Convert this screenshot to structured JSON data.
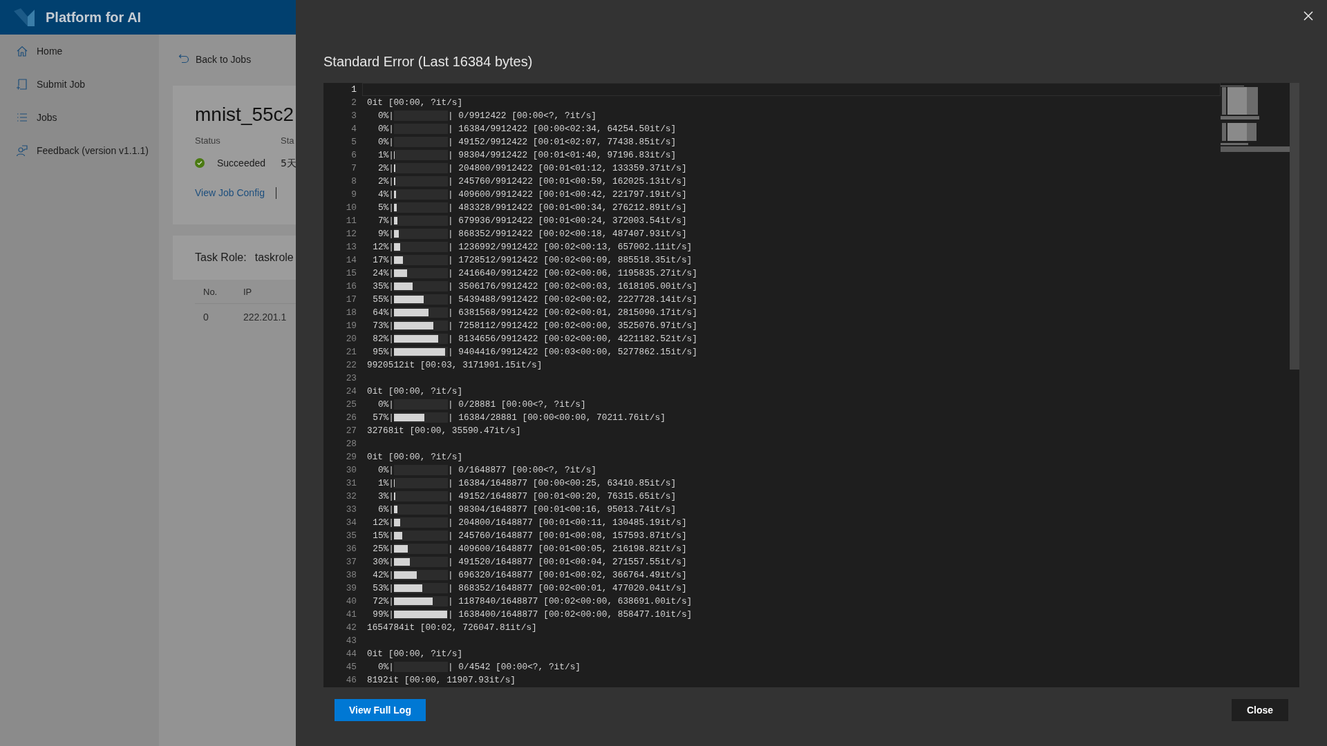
{
  "app": {
    "title": "Platform for AI"
  },
  "sidebar": {
    "items": [
      {
        "label": "Home"
      },
      {
        "label": "Submit Job"
      },
      {
        "label": "Jobs"
      },
      {
        "label": "Feedback (version v1.1.1)"
      }
    ]
  },
  "job": {
    "back": "Back to Jobs",
    "name": "mnist_55c2",
    "status_label": "Status",
    "start_label": "Sta",
    "status": "Succeeded",
    "start": "5天",
    "config_link": "View Job Config"
  },
  "task": {
    "label": "Task Role:",
    "value": "taskrole",
    "columns": [
      "No.",
      "IP"
    ],
    "rows": [
      [
        "0",
        "222.201.1"
      ]
    ]
  },
  "dialog": {
    "title": "Standard Error (Last 16384 bytes)",
    "full_log_button": "View Full Log",
    "close_button": "Close",
    "lines": [
      {
        "no": "1",
        "kind": "text",
        "current": true
      },
      {
        "no": "2",
        "kind": "text",
        "text": "0it [00:00, ?it/s]",
        "current": false
      },
      {
        "no": "3",
        "kind": "progress",
        "label": "0%|",
        "level": 0,
        "rest": "| 0/9912422 [00:00<?, ?it/s]",
        "current": false
      },
      {
        "no": "4",
        "kind": "progress",
        "label": "0%|",
        "level": 0,
        "rest": "| 16384/9912422 [00:00<02:34, 64254.50it/s]",
        "current": false
      },
      {
        "no": "5",
        "kind": "progress",
        "label": "0%|",
        "level": 0,
        "rest": "| 49152/9912422 [00:01<02:07, 77438.85it/s]",
        "current": false
      },
      {
        "no": "6",
        "kind": "progress",
        "label": "1%|",
        "level": 0.01,
        "rest": "| 98304/9912422 [00:01<01:40, 97196.83it/s]",
        "current": false
      },
      {
        "no": "7",
        "kind": "progress",
        "label": "2%|",
        "level": 0.02,
        "rest": "| 204800/9912422 [00:01<01:12, 133359.37it/s]",
        "current": false
      },
      {
        "no": "8",
        "kind": "progress",
        "label": "2%|",
        "level": 0.02,
        "rest": "| 245760/9912422 [00:01<00:59, 162025.13it/s]",
        "current": false
      },
      {
        "no": "9",
        "kind": "progress",
        "label": "4%|",
        "level": 0.04,
        "rest": "| 409600/9912422 [00:01<00:42, 221797.19it/s]",
        "current": false
      },
      {
        "no": "10",
        "kind": "progress",
        "label": "5%|",
        "level": 0.05,
        "rest": "| 483328/9912422 [00:01<00:34, 276212.89it/s]",
        "current": false
      },
      {
        "no": "11",
        "kind": "progress",
        "label": "7%|",
        "level": 0.07,
        "rest": "| 679936/9912422 [00:01<00:24, 372003.54it/s]",
        "current": false
      },
      {
        "no": "12",
        "kind": "progress",
        "label": "9%|",
        "level": 0.09,
        "rest": "| 868352/9912422 [00:02<00:18, 487407.93it/s]",
        "current": false
      },
      {
        "no": "13",
        "kind": "progress",
        "label": "12%|",
        "level": 0.12,
        "rest": "| 1236992/9912422 [00:02<00:13, 657002.11it/s]",
        "current": false
      },
      {
        "no": "14",
        "kind": "progress",
        "label": "17%|",
        "level": 0.17,
        "rest": "| 1728512/9912422 [00:02<00:09, 885518.35it/s]",
        "current": false
      },
      {
        "no": "15",
        "kind": "progress",
        "label": "24%|",
        "level": 0.24,
        "rest": "| 2416640/9912422 [00:02<00:06, 1195835.27it/s]",
        "current": false
      },
      {
        "no": "16",
        "kind": "progress",
        "label": "35%|",
        "level": 0.35,
        "rest": "| 3506176/9912422 [00:02<00:03, 1618105.00it/s]",
        "current": false
      },
      {
        "no": "17",
        "kind": "progress",
        "label": "55%|",
        "level": 0.55,
        "rest": "| 5439488/9912422 [00:02<00:02, 2227728.14it/s]",
        "current": false
      },
      {
        "no": "18",
        "kind": "progress",
        "label": "64%|",
        "level": 0.64,
        "rest": "| 6381568/9912422 [00:02<00:01, 2815090.17it/s]",
        "current": false
      },
      {
        "no": "19",
        "kind": "progress",
        "label": "73%|",
        "level": 0.73,
        "rest": "| 7258112/9912422 [00:02<00:00, 3525076.97it/s]",
        "current": false
      },
      {
        "no": "20",
        "kind": "progress",
        "label": "82%|",
        "level": 0.82,
        "rest": "| 8134656/9912422 [00:02<00:00, 4221182.52it/s]",
        "current": false
      },
      {
        "no": "21",
        "kind": "progress",
        "label": "95%|",
        "level": 0.95,
        "rest": "| 9404416/9912422 [00:03<00:00, 5277862.15it/s]",
        "current": false
      },
      {
        "no": "22",
        "kind": "text",
        "text": "9920512it [00:03, 3171901.15it/s]",
        "current": false
      },
      {
        "no": "23",
        "kind": "text",
        "current": false
      },
      {
        "no": "24",
        "kind": "text",
        "text": "0it [00:00, ?it/s]",
        "current": false
      },
      {
        "no": "25",
        "kind": "progress",
        "label": "0%|",
        "level": 0,
        "rest": "| 0/28881 [00:00<?, ?it/s]",
        "current": false
      },
      {
        "no": "26",
        "kind": "progress",
        "label": "57%|",
        "level": 0.57,
        "rest": "| 16384/28881 [00:00<00:00, 70211.76it/s]",
        "current": false
      },
      {
        "no": "27",
        "kind": "text",
        "text": "32768it [00:00, 35590.47it/s]",
        "current": false
      },
      {
        "no": "28",
        "kind": "text",
        "current": false
      },
      {
        "no": "29",
        "kind": "text",
        "text": "0it [00:00, ?it/s]",
        "current": false
      },
      {
        "no": "30",
        "kind": "progress",
        "label": "0%|",
        "level": 0,
        "rest": "| 0/1648877 [00:00<?, ?it/s]",
        "current": false
      },
      {
        "no": "31",
        "kind": "progress",
        "label": "1%|",
        "level": 0.01,
        "rest": "| 16384/1648877 [00:00<00:25, 63410.85it/s]",
        "current": false
      },
      {
        "no": "32",
        "kind": "progress",
        "label": "3%|",
        "level": 0.03,
        "rest": "| 49152/1648877 [00:01<00:20, 76315.65it/s]",
        "current": false
      },
      {
        "no": "33",
        "kind": "progress",
        "label": "6%|",
        "level": 0.06,
        "rest": "| 98304/1648877 [00:01<00:16, 95013.74it/s]",
        "current": false
      },
      {
        "no": "34",
        "kind": "progress",
        "label": "12%|",
        "level": 0.12,
        "rest": "| 204800/1648877 [00:01<00:11, 130485.19it/s]",
        "current": false
      },
      {
        "no": "35",
        "kind": "progress",
        "label": "15%|",
        "level": 0.15,
        "rest": "| 245760/1648877 [00:01<00:08, 157593.87it/s]",
        "current": false
      },
      {
        "no": "36",
        "kind": "progress",
        "label": "25%|",
        "level": 0.25,
        "rest": "| 409600/1648877 [00:01<00:05, 216198.82it/s]",
        "current": false
      },
      {
        "no": "37",
        "kind": "progress",
        "label": "30%|",
        "level": 0.3,
        "rest": "| 491520/1648877 [00:01<00:04, 271557.55it/s]",
        "current": false
      },
      {
        "no": "38",
        "kind": "progress",
        "label": "42%|",
        "level": 0.42,
        "rest": "| 696320/1648877 [00:01<00:02, 366764.49it/s]",
        "current": false
      },
      {
        "no": "39",
        "kind": "progress",
        "label": "53%|",
        "level": 0.53,
        "rest": "| 868352/1648877 [00:02<00:01, 477020.04it/s]",
        "current": false
      },
      {
        "no": "40",
        "kind": "progress",
        "label": "72%|",
        "level": 0.72,
        "rest": "| 1187840/1648877 [00:02<00:00, 638691.00it/s]",
        "current": false
      },
      {
        "no": "41",
        "kind": "progress",
        "label": "99%|",
        "level": 0.99,
        "rest": "| 1638400/1648877 [00:02<00:00, 858477.10it/s]",
        "current": false
      },
      {
        "no": "42",
        "kind": "text",
        "text": "1654784it [00:02, 726047.81it/s]",
        "current": false
      },
      {
        "no": "43",
        "kind": "text",
        "current": false
      },
      {
        "no": "44",
        "kind": "text",
        "text": "0it [00:00, ?it/s]",
        "current": false
      },
      {
        "no": "45",
        "kind": "progress",
        "label": "0%|",
        "level": 0,
        "rest": "| 0/4542 [00:00<?, ?it/s]",
        "current": false
      },
      {
        "no": "46",
        "kind": "text",
        "text": "8192it [00:00, 11907.93it/s]",
        "current": false
      }
    ]
  }
}
